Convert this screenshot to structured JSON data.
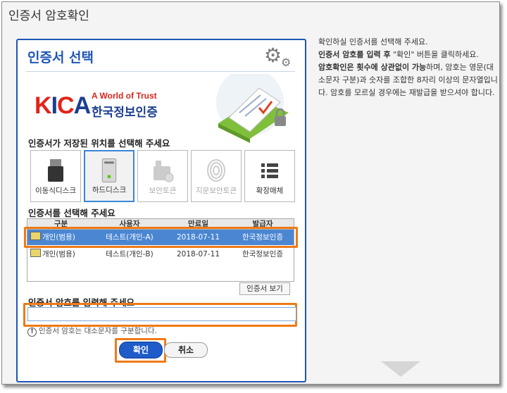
{
  "window": {
    "title": "인증서 암호확인"
  },
  "instructions": {
    "line1": "확인하실 인증서를 선택해 주세요.",
    "line2_bold": "인증서 암호를 입력 후",
    "line2_rest": " \"확인\" 버튼을 클릭하세요.",
    "line3_bold": "암호확인은 횟수에 상관없이 가능",
    "line3_rest": "하며, 암호는 영문(대소문자 구분)과 숫자를 조합한 8자리 이상의 문자열입니다. 암호를 모르실 경우에는 재발급을 받으셔야 합니다."
  },
  "dialog": {
    "title": "인증서 선택",
    "logo": {
      "brand": "KICA",
      "tagline": "A World of Trust",
      "korean": "한국정보인증"
    },
    "location_label": "인증서가 저장된 위치를 선택해 주세요",
    "locations": [
      {
        "label": "이동식디스크",
        "icon": "usb-drive-icon",
        "selected": false,
        "enabled": true
      },
      {
        "label": "하드디스크",
        "icon": "hard-disk-icon",
        "selected": true,
        "enabled": true
      },
      {
        "label": "보안토큰",
        "icon": "security-token-icon",
        "selected": false,
        "enabled": false
      },
      {
        "label": "지문보안토큰",
        "icon": "fingerprint-icon",
        "selected": false,
        "enabled": false
      },
      {
        "label": "확장매체",
        "icon": "list-icon",
        "selected": false,
        "enabled": true
      }
    ],
    "cert_label": "인증서를 선택해 주세요",
    "columns": [
      "구분",
      "사용자",
      "만료일",
      "발급자"
    ],
    "rows": [
      {
        "type": "개인(범용)",
        "user": "테스트(개인-A)",
        "expiry": "2018-07-11",
        "issuer": "한국정보인증"
      },
      {
        "type": "개인(범용)",
        "user": "테스트(개인-B)",
        "expiry": "2018-07-11",
        "issuer": "한국정보인증"
      }
    ],
    "view_cert_label": "인증서 보기",
    "password_label": "인증서 암호를 입력해 주세요",
    "password_value": "",
    "hint": "인증서 암호는 대소문자를 구분합니다.",
    "ok_label": "확인",
    "cancel_label": "취소"
  },
  "colors": {
    "accent": "#1f56b6",
    "highlight": "#ef7a16",
    "selected_row": "#4a86d2"
  }
}
